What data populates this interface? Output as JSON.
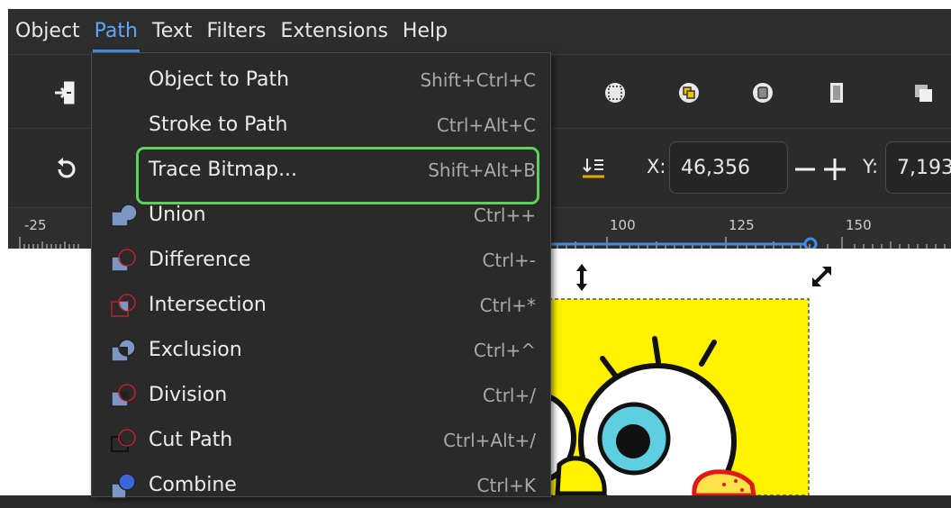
{
  "menubar": {
    "items": [
      {
        "label": "Object"
      },
      {
        "label": "Path"
      },
      {
        "label": "Text"
      },
      {
        "label": "Filters"
      },
      {
        "label": "Extensions"
      },
      {
        "label": "Help"
      }
    ],
    "active": "Path"
  },
  "toolbar": {
    "icons": [
      "import-icon",
      "bbox-icon",
      "group-icon",
      "object-icon",
      "page-icon",
      "copy-icon",
      "undo-icon",
      "baseline-icon",
      "resize-cursor-icon"
    ],
    "x_label": "X:",
    "x_value": "46,356",
    "y_label": "Y:",
    "y_value": "7,193"
  },
  "ruler": {
    "labels": [
      "-25",
      "100",
      "125",
      "150"
    ]
  },
  "path_menu": {
    "items": [
      {
        "label": "Object to Path",
        "shortcut": "Shift+Ctrl+C",
        "icon": ""
      },
      {
        "label": "Stroke to Path",
        "shortcut": "Ctrl+Alt+C",
        "icon": ""
      },
      {
        "label": "Trace Bitmap...",
        "shortcut": "Shift+Alt+B",
        "icon": "",
        "highlighted": true
      },
      {
        "label": "Union",
        "shortcut": "Ctrl++",
        "icon": "union-icon"
      },
      {
        "label": "Difference",
        "shortcut": "Ctrl+-",
        "icon": "difference-icon"
      },
      {
        "label": "Intersection",
        "shortcut": "Ctrl+*",
        "icon": "intersection-icon"
      },
      {
        "label": "Exclusion",
        "shortcut": "Ctrl+^",
        "icon": "exclusion-icon"
      },
      {
        "label": "Division",
        "shortcut": "Ctrl+/",
        "icon": "division-icon"
      },
      {
        "label": "Cut Path",
        "shortcut": "Ctrl+Alt+/",
        "icon": "cut-path-icon"
      },
      {
        "label": "Combine",
        "shortcut": "Ctrl+K",
        "icon": "combine-icon"
      }
    ]
  },
  "colors": {
    "menu_bg": "#2a2a2a",
    "accent": "#4a90e2",
    "highlight": "#5bd35b",
    "canvas_yellow": "#fff200",
    "eye_blue": "#5ecfe0"
  }
}
